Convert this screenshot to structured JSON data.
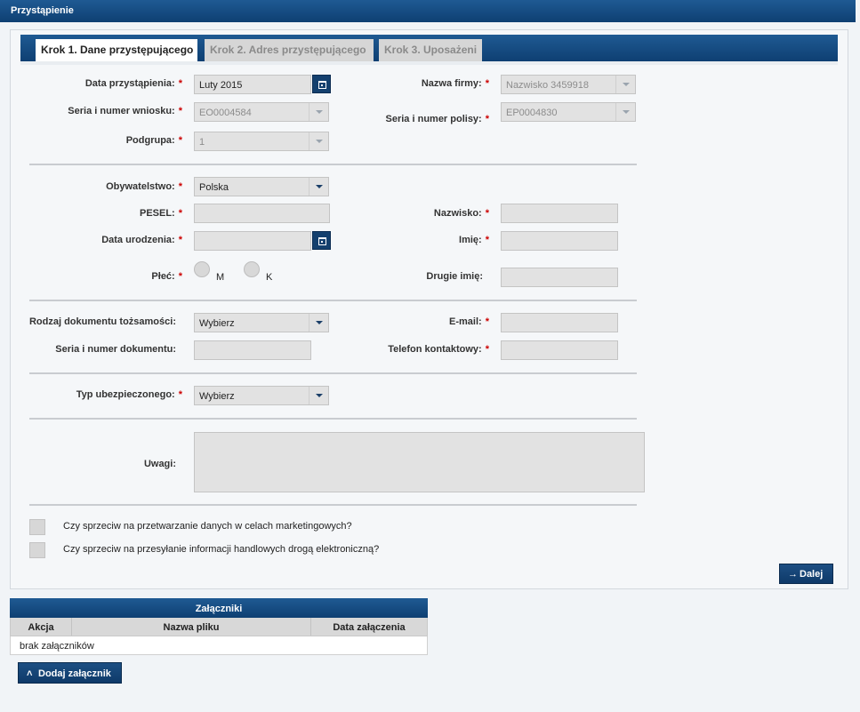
{
  "window": {
    "title": "Przystąpienie"
  },
  "tabs": [
    {
      "label": "Krok 1. Dane przystępującego",
      "active": true
    },
    {
      "label": "Krok 2. Adres przystępującego",
      "active": false
    },
    {
      "label": "Krok 3. Uposażeni",
      "active": false
    }
  ],
  "required_marker": "*",
  "form": {
    "data_przystapienia": {
      "label": "Data przystąpienia:",
      "value": "Luty 2015"
    },
    "nazwa_firmy": {
      "label": "Nazwa firmy:",
      "value": "Nazwisko 3459918"
    },
    "seria_wniosku": {
      "label": "Seria i numer wniosku:",
      "value": "EO0004584"
    },
    "seria_polisy": {
      "label": "Seria i numer polisy:",
      "value": "EP0004830"
    },
    "podgrupa": {
      "label": "Podgrupa:",
      "value": "1"
    },
    "obywatelstwo": {
      "label": "Obywatelstwo:",
      "value": "Polska"
    },
    "pesel": {
      "label": "PESEL:",
      "value": ""
    },
    "nazwisko": {
      "label": "Nazwisko:",
      "value": ""
    },
    "data_urodzenia": {
      "label": "Data urodzenia:",
      "value": ""
    },
    "imie": {
      "label": "Imię:",
      "value": ""
    },
    "plec": {
      "label": "Płeć:",
      "options": [
        "M",
        "K"
      ]
    },
    "drugie_imie": {
      "label": "Drugie imię:",
      "value": ""
    },
    "rodzaj_dokumentu": {
      "label": "Rodzaj dokumentu tożsamości:",
      "value": "Wybierz"
    },
    "email": {
      "label": "E-mail:",
      "value": ""
    },
    "seria_dokumentu": {
      "label": "Seria i numer dokumentu:",
      "value": ""
    },
    "telefon": {
      "label": "Telefon kontaktowy:",
      "value": ""
    },
    "typ_ubezpieczonego": {
      "label": "Typ ubezpieczonego:",
      "value": "Wybierz"
    },
    "uwagi": {
      "label": "Uwagi:",
      "value": ""
    }
  },
  "consents": [
    {
      "label": "Czy sprzeciw na przetwarzanie danych w celach marketingowych?",
      "checked": false
    },
    {
      "label": "Czy sprzeciw na przesyłanie informacji handlowych drogą elektroniczną?",
      "checked": false
    }
  ],
  "next_button": {
    "label": "Dalej",
    "icon": "arrow-right-icon"
  },
  "attachments": {
    "title": "Załączniki",
    "columns": [
      "Akcja",
      "Nazwa pliku",
      "Data załączenia"
    ],
    "empty_text": "brak załączników",
    "add_button": {
      "label": "Dodaj załącznik",
      "icon": "chevron-up-icon"
    }
  }
}
